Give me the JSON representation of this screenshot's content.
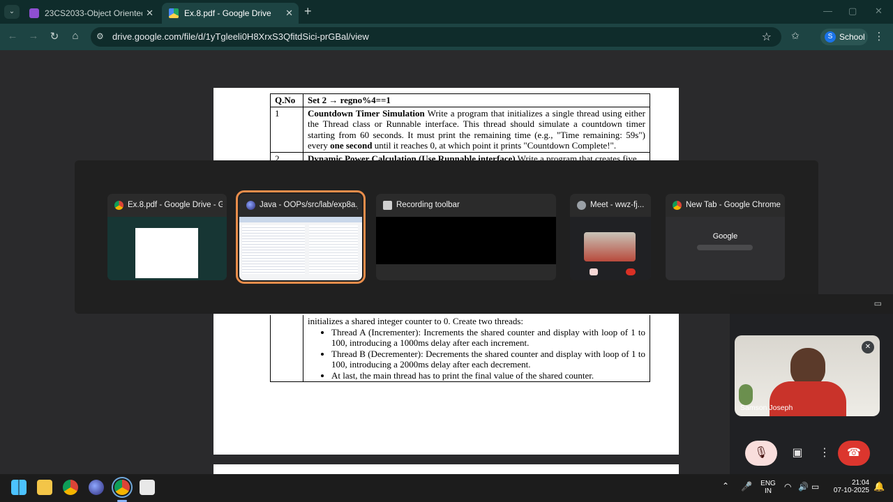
{
  "tabs": [
    {
      "title": "23CS2033-Object Oriented Prog",
      "close": "✕"
    },
    {
      "title": "Ex.8.pdf - Google Drive",
      "close": "✕"
    }
  ],
  "new_tab_symbol": "+",
  "window_controls": {
    "minimize": "—",
    "maximize": "▢",
    "close": "✕"
  },
  "address_bar": {
    "url": "drive.google.com/file/d/1yTgleeli0H8XrxS3QfitdSici-prGBal/view"
  },
  "profile": {
    "initial": "S",
    "name": "School"
  },
  "pdf": {
    "header_qno": "Q.No",
    "header_set": "Set 2 → regno%4==1",
    "row1_no": "1",
    "row1_title": "Countdown Timer Simulation",
    "row1_text_a": " Write a program that initializes a single thread using either the Thread class or Runnable interface. This thread should simulate a countdown timer starting from 60 seconds. It must print the remaining time (e.g., \"Time remaining: 59s\") every ",
    "row1_bold": "one second",
    "row1_text_b": " until it reaches 0, at which point it prints \"Countdown Complete!\".",
    "row2_no": "2",
    "row2_title": "Dynamic Power Calculation (Use Runnable interface)",
    "row2_text": " Write a program that creates five",
    "row3_intro": "initializes a shared integer counter to 0. Create two threads:",
    "row3_bullets": [
      "Thread A (Incrementer): Increments the shared counter and display with loop of 1 to 100, introducing a 1000ms delay after each increment.",
      "Thread B (Decrementer): Decrements the shared counter and display with loop of 1 to 100, introducing a 2000ms delay after each decrement.",
      "At last, the main thread has to print the final value of the shared counter."
    ]
  },
  "switcher": {
    "windows": [
      {
        "title": "Ex.8.pdf - Google Drive - G...",
        "icon": "chrome-icon"
      },
      {
        "title": "Java - OOPs/src/lab/exp8a.j...",
        "icon": "eclipse-icon",
        "selected": true
      },
      {
        "title": "Recording toolbar",
        "icon": "recording-icon"
      },
      {
        "title": "Meet - wwz-fj...",
        "icon": "globe-icon"
      },
      {
        "title": "New Tab - Google Chrome",
        "icon": "chrome-icon"
      }
    ],
    "newtab_preview_brand": "Google"
  },
  "meet": {
    "participant_name": "Samson Joseph"
  },
  "taskbar": {
    "lang_top": "ENG",
    "lang_bottom": "IN",
    "time": "21:04",
    "date": "07-10-2025"
  }
}
